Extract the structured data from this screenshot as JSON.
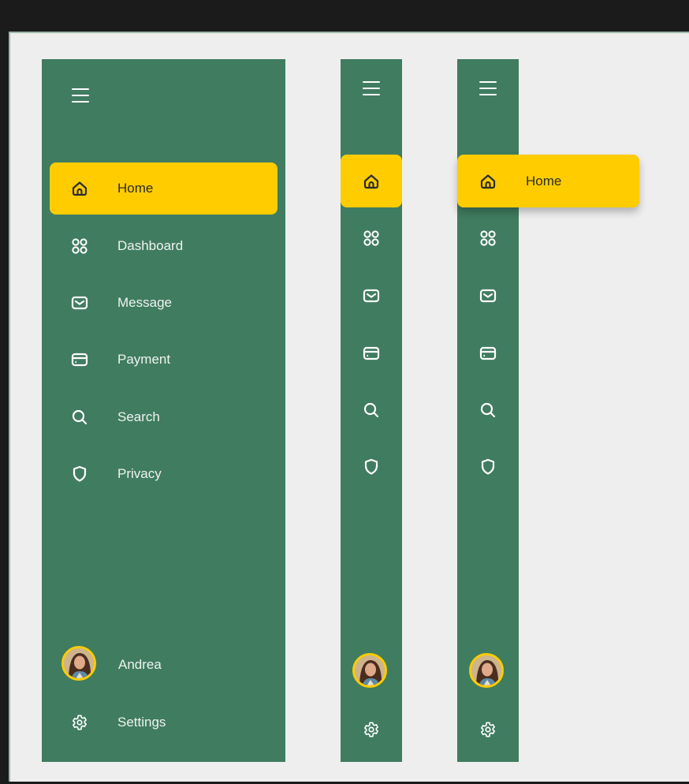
{
  "colors": {
    "panel": "#407c60",
    "accent": "#ffcc00",
    "background": "#eeeeee"
  },
  "nav": {
    "items": [
      {
        "label": "Home",
        "icon": "home-icon",
        "active": true
      },
      {
        "label": "Dashboard",
        "icon": "dashboard-icon"
      },
      {
        "label": "Message",
        "icon": "mail-icon"
      },
      {
        "label": "Payment",
        "icon": "card-icon"
      },
      {
        "label": "Search",
        "icon": "search-icon"
      },
      {
        "label": "Privacy",
        "icon": "shield-icon"
      }
    ],
    "user": {
      "name": "Andrea"
    },
    "settings": {
      "label": "Settings"
    }
  }
}
